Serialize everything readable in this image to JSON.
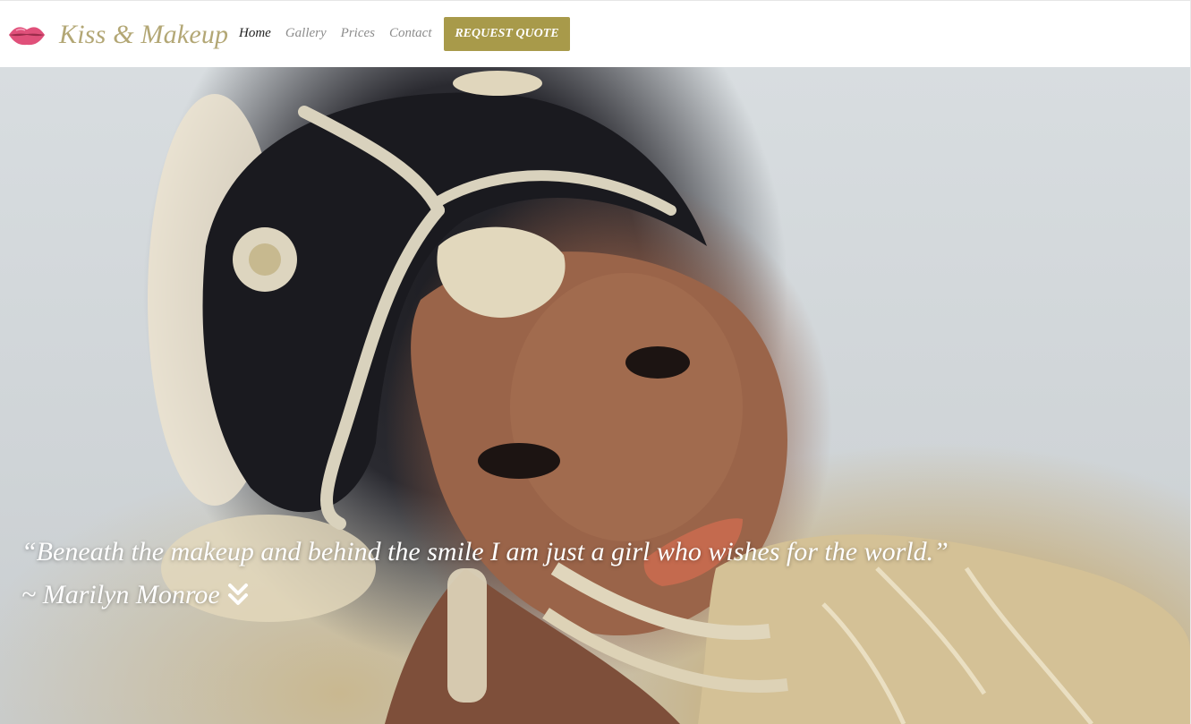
{
  "header": {
    "brand": "Kiss & Makeup",
    "logo_icon": "lips-icon",
    "nav": [
      {
        "label": "Home",
        "active": true
      },
      {
        "label": "Gallery",
        "active": false
      },
      {
        "label": "Prices",
        "active": false
      },
      {
        "label": "Contact",
        "active": false
      }
    ],
    "cta_label": "Request Quote"
  },
  "hero": {
    "quote": "“Beneath the makeup and behind the smile I am just a girl who wishes for the world.”",
    "author": "~ Marilyn Monroe",
    "scroll_icon": "double-chevron-down-icon"
  },
  "colors": {
    "brand_text": "#b3a775",
    "button_bg": "#a89a4a",
    "nav_active": "#222222",
    "nav_inactive": "#8c8c8c",
    "lips": "#e0507a"
  }
}
